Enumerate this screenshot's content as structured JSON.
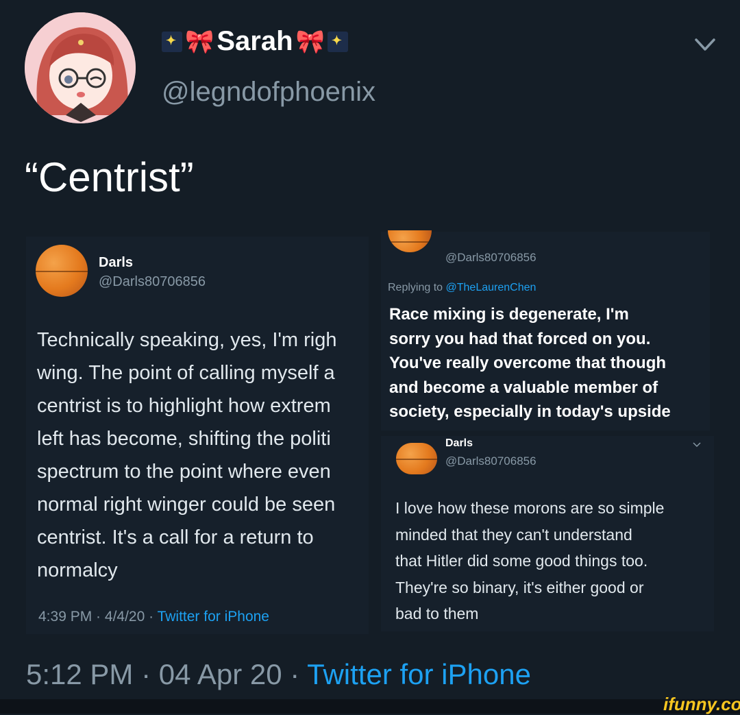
{
  "header": {
    "display_name": "Sarah",
    "handle": "@legndofphoenix"
  },
  "tweet": {
    "text": "“Centrist”",
    "time": "5:12 PM",
    "date": "04 Apr 20",
    "source": "Twitter for iPhone"
  },
  "quoted_left": {
    "name": "Darls",
    "handle": "@Darls80706856",
    "lines": [
      "Technically speaking, yes, I'm righ",
      "wing. The point of calling myself a",
      "centrist is to highlight how extrem",
      "left has become, shifting the politi",
      "spectrum to the point where even",
      "normal right winger could be seen",
      "centrist. It's a call for a return to",
      "normalcy"
    ],
    "time": "4:39 PM",
    "date": "4/4/20",
    "source": "Twitter for iPhone"
  },
  "quoted_right_top": {
    "handle": "@Darls80706856",
    "replying_prefix": "Replying to",
    "replying_to": "@TheLaurenChen",
    "lines": [
      "Race mixing is degenerate, I'm",
      "sorry you had that forced on you.",
      "You've really overcome that though",
      "and become a valuable member of",
      "society, especially in today's upside"
    ]
  },
  "quoted_right_bottom": {
    "name": "Darls",
    "handle": "@Darls80706856",
    "lines": [
      "I love how these morons are so simple",
      "minded that they can't understand",
      "that Hitler did some good things too.",
      "They're so binary, it's either good or",
      "bad to them"
    ]
  },
  "watermark": "ifunny.co",
  "colors": {
    "background": "#141d26",
    "card": "#16202b",
    "secondary_text": "#8899a6",
    "link": "#1da1f2"
  }
}
